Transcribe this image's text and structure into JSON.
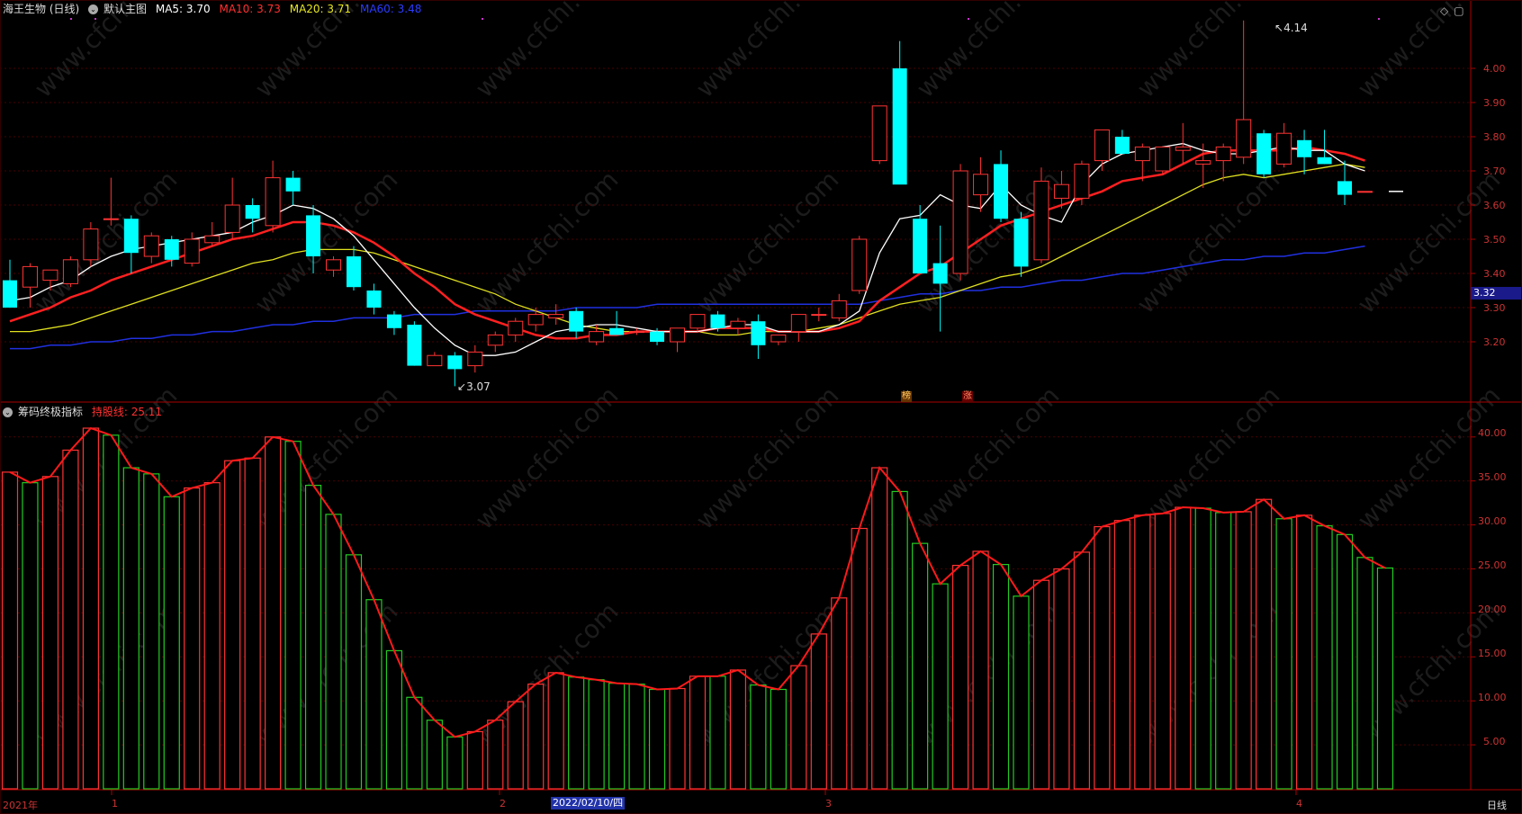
{
  "header_main": {
    "title": "海王生物 (日线)",
    "template": "默认主图",
    "ma5": "MA5: 3.70",
    "ma10": "MA10: 3.73",
    "ma20": "MA20: 3.71",
    "ma60": "MA60: 3.48"
  },
  "header_sub": {
    "title": "筹码终极指标",
    "line_label": "持股线: 25.11"
  },
  "price_axis": [
    "4.00",
    "3.90",
    "3.80",
    "3.70",
    "3.60",
    "3.50",
    "3.40",
    "3.30",
    "3.20"
  ],
  "current_price": "3.32",
  "sub_axis": [
    "40.00",
    "35.00",
    "30.00",
    "25.00",
    "20.00",
    "15.00",
    "10.00",
    "5.00"
  ],
  "high_label": "4.14",
  "low_label": "3.07",
  "tags": {
    "bang": "榜",
    "zhang": "涨"
  },
  "bottom_axis": {
    "year": "2021年",
    "m1": "1",
    "m2": "2",
    "date_cursor": "2022/02/10/四",
    "m3": "3",
    "m4": "4",
    "period": "日线"
  },
  "colors": {
    "up": "#ff3333",
    "down": "#00ffff",
    "ma5": "#ffffff",
    "ma10": "#ff2020",
    "ma20": "#e0e020",
    "ma60": "#2030e0",
    "bar_down": "#22cc22",
    "grid": "#4a0000"
  },
  "chart_data": {
    "type": "candlestick",
    "ohlc": [
      [
        3.38,
        3.44,
        3.32,
        3.3
      ],
      [
        3.36,
        3.43,
        3.3,
        3.42
      ],
      [
        3.38,
        3.4,
        3.35,
        3.41
      ],
      [
        3.37,
        3.45,
        3.36,
        3.44
      ],
      [
        3.44,
        3.55,
        3.42,
        3.53
      ],
      [
        3.56,
        3.68,
        3.54,
        3.56
      ],
      [
        3.56,
        3.57,
        3.4,
        3.46
      ],
      [
        3.45,
        3.52,
        3.43,
        3.51
      ],
      [
        3.5,
        3.51,
        3.42,
        3.44
      ],
      [
        3.43,
        3.52,
        3.42,
        3.5
      ],
      [
        3.49,
        3.55,
        3.48,
        3.51
      ],
      [
        3.52,
        3.68,
        3.5,
        3.6
      ],
      [
        3.6,
        3.62,
        3.52,
        3.56
      ],
      [
        3.54,
        3.73,
        3.52,
        3.68
      ],
      [
        3.68,
        3.7,
        3.6,
        3.64
      ],
      [
        3.57,
        3.6,
        3.4,
        3.45
      ],
      [
        3.41,
        3.45,
        3.39,
        3.44
      ],
      [
        3.45,
        3.48,
        3.35,
        3.36
      ],
      [
        3.35,
        3.37,
        3.28,
        3.3
      ],
      [
        3.28,
        3.29,
        3.22,
        3.24
      ],
      [
        3.25,
        3.26,
        3.13,
        3.13
      ],
      [
        3.13,
        3.17,
        3.13,
        3.16
      ],
      [
        3.16,
        3.17,
        3.07,
        3.12
      ],
      [
        3.13,
        3.19,
        3.11,
        3.17
      ],
      [
        3.19,
        3.23,
        3.17,
        3.22
      ],
      [
        3.22,
        3.27,
        3.2,
        3.26
      ],
      [
        3.25,
        3.3,
        3.23,
        3.28
      ],
      [
        3.27,
        3.31,
        3.25,
        3.28
      ],
      [
        3.29,
        3.3,
        3.21,
        3.23
      ],
      [
        3.2,
        3.25,
        3.19,
        3.23
      ],
      [
        3.24,
        3.29,
        3.23,
        3.22
      ],
      [
        3.23,
        3.24,
        3.22,
        3.23
      ],
      [
        3.23,
        3.24,
        3.19,
        3.2
      ],
      [
        3.2,
        3.24,
        3.17,
        3.24
      ],
      [
        3.24,
        3.28,
        3.23,
        3.28
      ],
      [
        3.28,
        3.29,
        3.23,
        3.24
      ],
      [
        3.24,
        3.27,
        3.22,
        3.26
      ],
      [
        3.26,
        3.28,
        3.15,
        3.19
      ],
      [
        3.2,
        3.21,
        3.19,
        3.22
      ],
      [
        3.23,
        3.28,
        3.2,
        3.28
      ],
      [
        3.28,
        3.3,
        3.26,
        3.28
      ],
      [
        3.27,
        3.34,
        3.26,
        3.32
      ],
      [
        3.35,
        3.51,
        3.34,
        3.5
      ],
      [
        3.73,
        3.89,
        3.72,
        3.89
      ],
      [
        4.0,
        4.08,
        3.7,
        3.66
      ],
      [
        3.56,
        3.6,
        3.4,
        3.4
      ],
      [
        3.43,
        3.54,
        3.23,
        3.37
      ],
      [
        3.4,
        3.72,
        3.38,
        3.7
      ],
      [
        3.63,
        3.74,
        3.58,
        3.69
      ],
      [
        3.72,
        3.76,
        3.55,
        3.56
      ],
      [
        3.56,
        3.58,
        3.39,
        3.42
      ],
      [
        3.44,
        3.71,
        3.43,
        3.67
      ],
      [
        3.62,
        3.7,
        3.59,
        3.66
      ],
      [
        3.62,
        3.73,
        3.6,
        3.72
      ],
      [
        3.73,
        3.82,
        3.7,
        3.82
      ],
      [
        3.8,
        3.82,
        3.75,
        3.75
      ],
      [
        3.73,
        3.78,
        3.67,
        3.77
      ],
      [
        3.7,
        3.76,
        3.69,
        3.77
      ],
      [
        3.76,
        3.84,
        3.72,
        3.77
      ],
      [
        3.72,
        3.78,
        3.65,
        3.73
      ],
      [
        3.73,
        3.78,
        3.67,
        3.77
      ],
      [
        3.74,
        4.14,
        3.72,
        3.85
      ],
      [
        3.81,
        3.82,
        3.68,
        3.69
      ],
      [
        3.72,
        3.84,
        3.71,
        3.81
      ],
      [
        3.79,
        3.82,
        3.69,
        3.74
      ],
      [
        3.74,
        3.82,
        3.72,
        3.72
      ],
      [
        3.67,
        3.73,
        3.6,
        3.63
      ],
      [
        3.64,
        3.64,
        3.64,
        3.64
      ]
    ],
    "ma5": [
      3.32,
      3.33,
      3.36,
      3.38,
      3.42,
      3.45,
      3.47,
      3.48,
      3.49,
      3.5,
      3.51,
      3.52,
      3.55,
      3.57,
      3.6,
      3.59,
      3.56,
      3.51,
      3.44,
      3.37,
      3.3,
      3.24,
      3.19,
      3.16,
      3.16,
      3.17,
      3.2,
      3.23,
      3.24,
      3.25,
      3.25,
      3.24,
      3.23,
      3.23,
      3.23,
      3.24,
      3.25,
      3.25,
      3.23,
      3.23,
      3.23,
      3.25,
      3.29,
      3.46,
      3.56,
      3.57,
      3.63,
      3.6,
      3.59,
      3.66,
      3.6,
      3.57,
      3.55,
      3.66,
      3.72,
      3.75,
      3.76,
      3.77,
      3.78,
      3.76,
      3.75,
      3.75,
      3.76,
      3.77,
      3.76,
      3.76,
      3.72,
      3.7
    ],
    "ma10": [
      3.26,
      3.28,
      3.3,
      3.33,
      3.35,
      3.38,
      3.4,
      3.42,
      3.44,
      3.46,
      3.48,
      3.5,
      3.51,
      3.53,
      3.55,
      3.55,
      3.54,
      3.52,
      3.49,
      3.45,
      3.4,
      3.36,
      3.31,
      3.28,
      3.26,
      3.24,
      3.22,
      3.21,
      3.21,
      3.22,
      3.22,
      3.23,
      3.23,
      3.23,
      3.23,
      3.24,
      3.24,
      3.24,
      3.23,
      3.23,
      3.23,
      3.24,
      3.26,
      3.32,
      3.36,
      3.4,
      3.42,
      3.46,
      3.5,
      3.54,
      3.56,
      3.58,
      3.6,
      3.62,
      3.64,
      3.67,
      3.68,
      3.69,
      3.72,
      3.75,
      3.76,
      3.76,
      3.76,
      3.76,
      3.77,
      3.76,
      3.75,
      3.73
    ],
    "ma20": [
      3.23,
      3.23,
      3.24,
      3.25,
      3.27,
      3.29,
      3.31,
      3.33,
      3.35,
      3.37,
      3.39,
      3.41,
      3.43,
      3.44,
      3.46,
      3.47,
      3.47,
      3.47,
      3.46,
      3.44,
      3.42,
      3.4,
      3.38,
      3.36,
      3.34,
      3.31,
      3.29,
      3.27,
      3.25,
      3.24,
      3.23,
      3.23,
      3.23,
      3.23,
      3.23,
      3.22,
      3.22,
      3.23,
      3.23,
      3.23,
      3.24,
      3.25,
      3.27,
      3.29,
      3.31,
      3.32,
      3.33,
      3.35,
      3.37,
      3.39,
      3.4,
      3.42,
      3.45,
      3.48,
      3.51,
      3.54,
      3.57,
      3.6,
      3.63,
      3.66,
      3.68,
      3.69,
      3.68,
      3.69,
      3.7,
      3.71,
      3.72,
      3.71
    ],
    "ma60": [
      3.18,
      3.18,
      3.19,
      3.19,
      3.2,
      3.2,
      3.21,
      3.21,
      3.22,
      3.22,
      3.23,
      3.23,
      3.24,
      3.25,
      3.25,
      3.26,
      3.26,
      3.27,
      3.27,
      3.27,
      3.28,
      3.28,
      3.28,
      3.29,
      3.29,
      3.29,
      3.29,
      3.29,
      3.3,
      3.3,
      3.3,
      3.3,
      3.31,
      3.31,
      3.31,
      3.31,
      3.31,
      3.31,
      3.31,
      3.31,
      3.31,
      3.31,
      3.31,
      3.32,
      3.33,
      3.34,
      3.34,
      3.35,
      3.35,
      3.36,
      3.36,
      3.37,
      3.38,
      3.38,
      3.39,
      3.4,
      3.4,
      3.41,
      3.42,
      3.43,
      3.44,
      3.44,
      3.45,
      3.45,
      3.46,
      3.46,
      3.47,
      3.48
    ],
    "sub_values": [
      36.0,
      34.8,
      35.5,
      38.5,
      41.0,
      40.2,
      36.5,
      35.8,
      33.2,
      34.2,
      34.8,
      37.3,
      37.6,
      40.0,
      39.5,
      34.5,
      31.2,
      26.6,
      21.5,
      15.7,
      10.4,
      7.8,
      5.9,
      6.5,
      7.8,
      9.9,
      11.9,
      13.2,
      12.7,
      12.4,
      12.0,
      11.9,
      11.3,
      11.4,
      12.8,
      12.8,
      13.5,
      11.8,
      11.3,
      14.0,
      17.6,
      21.7,
      29.6,
      36.5,
      33.8,
      27.9,
      23.3,
      25.4,
      27.0,
      25.5,
      21.9,
      23.7,
      25.0,
      26.9,
      29.8,
      30.5,
      31.1,
      31.3,
      32.0,
      31.9,
      31.4,
      31.5,
      32.9,
      30.7,
      31.1,
      29.9,
      28.9,
      26.3,
      25.1
    ],
    "sub_up": [
      1,
      0,
      1,
      1,
      1,
      0,
      0,
      0,
      0,
      1,
      1,
      1,
      1,
      1,
      0,
      0,
      0,
      0,
      0,
      0,
      0,
      0,
      0,
      1,
      1,
      1,
      1,
      1,
      0,
      0,
      0,
      0,
      0,
      1,
      1,
      0,
      1,
      0,
      0,
      1,
      1,
      1,
      1,
      1,
      0,
      0,
      0,
      1,
      1,
      0,
      0,
      1,
      1,
      1,
      1,
      1,
      1,
      1,
      1,
      0,
      0,
      1,
      1,
      0,
      1,
      0,
      0,
      0,
      0
    ]
  }
}
